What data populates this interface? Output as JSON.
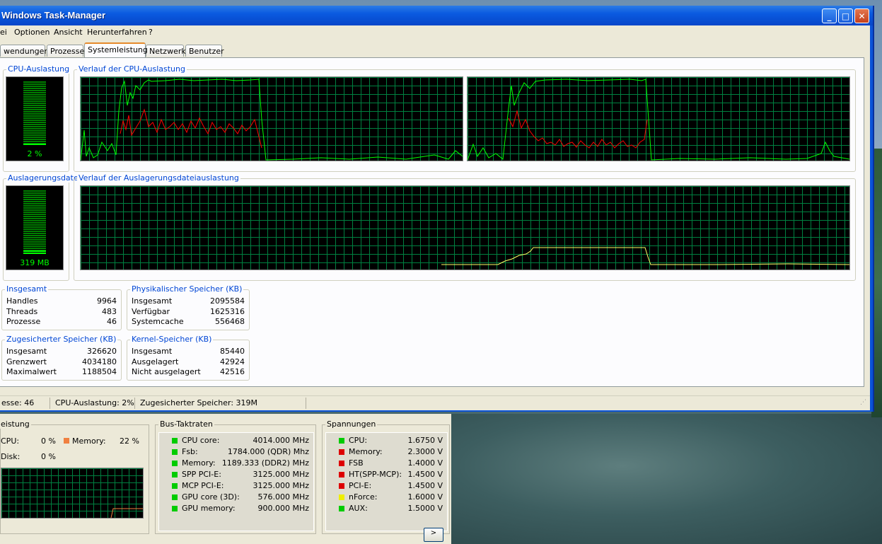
{
  "window": {
    "title": "Windows Task-Manager",
    "minimize": "_",
    "maximize": "□",
    "close": "✕"
  },
  "menu": [
    "ei",
    "Optionen",
    "Ansicht",
    "Herunterfahren",
    "?"
  ],
  "tabs": [
    "wendungen",
    "Prozesse",
    "Systemleistung",
    "Netzwerk",
    "Benutzer"
  ],
  "cpu": {
    "label": "CPU-Auslastung",
    "value": "2 %",
    "level": 0.02
  },
  "cpu_history": {
    "label": "Verlauf der CPU-Auslastung"
  },
  "pagefile": {
    "label": "Auslagerungsdatei",
    "value": "319 MB",
    "level": 0.15
  },
  "pagefile_history": {
    "label": "Verlauf der Auslagerungsdateiauslastung"
  },
  "totals": {
    "label": "Insgesamt",
    "rows": [
      [
        "Handles",
        "9964"
      ],
      [
        "Threads",
        "483"
      ],
      [
        "Prozesse",
        "46"
      ]
    ]
  },
  "physical": {
    "label": "Physikalischer Speicher (KB)",
    "rows": [
      [
        "Insgesamt",
        "2095584"
      ],
      [
        "Verfügbar",
        "1625316"
      ],
      [
        "Systemcache",
        "556468"
      ]
    ]
  },
  "commit": {
    "label": "Zugesicherter Speicher (KB)",
    "rows": [
      [
        "Insgesamt",
        "326620"
      ],
      [
        "Grenzwert",
        "4034180"
      ],
      [
        "Maximalwert",
        "1188504"
      ]
    ]
  },
  "kernel": {
    "label": "Kernel-Speicher (KB)",
    "rows": [
      [
        "Insgesamt",
        "85440"
      ],
      [
        "Ausgelagert",
        "42924"
      ],
      [
        "Nicht ausgelagert",
        "42516"
      ]
    ]
  },
  "status": {
    "processes": "esse: 46",
    "cpu": "CPU-Auslastung: 2%",
    "commit": "Zugesicherter Speicher: 319M"
  },
  "perf": {
    "label": "eistung",
    "cpu_label": "CPU:",
    "cpu_value": "0 %",
    "memory_label": "Memory:",
    "memory_value": "22 %",
    "disk_label": "Disk:",
    "disk_value": "0 %"
  },
  "bus": {
    "label": "Bus-Taktraten",
    "rows": [
      {
        "name": "CPU core:",
        "value": "4014.000 MHz",
        "color": "#00cc00"
      },
      {
        "name": "Fsb:",
        "value": "1784.000 (QDR) Mhz",
        "color": "#00cc00"
      },
      {
        "name": "Memory:",
        "value": "1189.333 (DDR2) MHz",
        "color": "#00cc00"
      },
      {
        "name": "SPP PCI-E:",
        "value": "3125.000 MHz",
        "color": "#00cc00"
      },
      {
        "name": "MCP PCI-E:",
        "value": "3125.000 MHz",
        "color": "#00cc00"
      },
      {
        "name": "GPU core (3D):",
        "value": "576.000 MHz",
        "color": "#00cc00"
      },
      {
        "name": "GPU memory:",
        "value": "900.000 MHz",
        "color": "#00cc00"
      }
    ]
  },
  "voltages": {
    "label": "Spannungen",
    "rows": [
      {
        "name": "CPU:",
        "value": "1.6750 V",
        "color": "#00cc00"
      },
      {
        "name": "Memory:",
        "value": "2.3000 V",
        "color": "#dd0000"
      },
      {
        "name": "FSB",
        "value": "1.4000 V",
        "color": "#dd0000"
      },
      {
        "name": "HT(SPP-MCP):",
        "value": "1.4500 V",
        "color": "#dd0000"
      },
      {
        "name": "PCI-E:",
        "value": "1.4500 V",
        "color": "#dd0000"
      },
      {
        "name": "nForce:",
        "value": "1.6000 V",
        "color": "#eeee00"
      },
      {
        "name": "AUX:",
        "value": "1.5000 V",
        "color": "#00cc00"
      }
    ]
  },
  "colors": {
    "accent": "#0046d5",
    "graph_green": "#00ff00",
    "kernel_red": "#ff0000",
    "memory_orange": "#f08040"
  },
  "button2": ">"
}
